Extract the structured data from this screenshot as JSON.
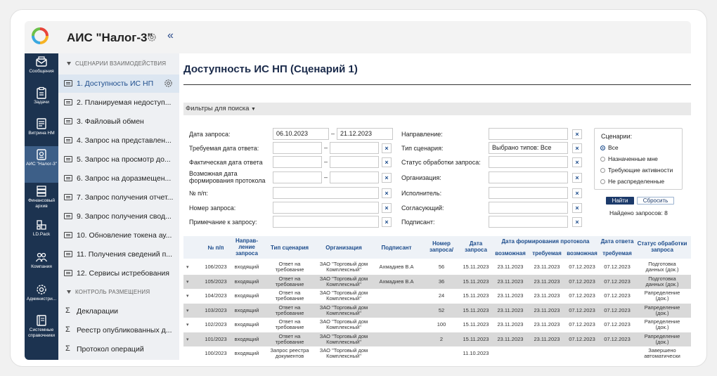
{
  "header": {
    "app_title": "АИС \"Налог-3\"",
    "collapse_glyph": "«"
  },
  "rail": [
    {
      "label": "Сообщения",
      "icon": "message-icon"
    },
    {
      "label": "Задачи",
      "icon": "clipboard-icon"
    },
    {
      "label": "Витрина НМ",
      "icon": "storefront-icon"
    },
    {
      "label": "АИС \"Налог-3\"",
      "icon": "database-icon",
      "active": true
    },
    {
      "label": "Финансовый архив",
      "icon": "archive-icon"
    },
    {
      "label": "LD.Pack",
      "icon": "package-icon"
    },
    {
      "label": "Компания",
      "icon": "people-icon"
    },
    {
      "label": "Администри...",
      "icon": "settings-icon"
    },
    {
      "label": "Системные справочники",
      "icon": "book-icon"
    }
  ],
  "nav": {
    "section1": "СЦЕНАРИИ ВЗАИМОДЕЙСТВИЯ",
    "items": [
      "1. Доступность ИС НП",
      "2. Планируемая недоступ...",
      "3. Файловый обмен",
      "4. Запрос на представлен...",
      "5. Запрос на просмотр до...",
      "6. Запрос на доразмещен...",
      "7. Запрос получения отчет...",
      "9. Запрос получения свод...",
      "10. Обновление токена ау...",
      "11. Получения сведений п...",
      "12. Сервисы истребования"
    ],
    "section2": "КОНТРОЛЬ РАЗМЕЩЕНИЯ",
    "items2": [
      "Декларации",
      "Реестр опубликованных д...",
      "Протокол операций"
    ],
    "sigma": "Σ"
  },
  "main": {
    "title": "Доступность ИС НП (Сценарий 1)",
    "filters_label": "Фильтры для поиска",
    "filter_icon": "▼"
  },
  "filters": {
    "date_request": "Дата запроса:",
    "date_from": "06.10.2023",
    "date_to": "21.12.2023",
    "required_answer": "Требуемая дата ответа:",
    "actual_date": "Фактическая дата ответа",
    "possible_date": "Возможная дата формирования протокола",
    "number": "№ п/п:",
    "request_number": "Номер запроса:",
    "note": "Примечание к запросу:",
    "direction": "Направление:",
    "scenario_type": "Тип сценария:",
    "scenario_type_value": "Выбрано типов: Все",
    "status": "Статус обработки запроса:",
    "organization": "Организация:",
    "executor": "Исполнитель:",
    "approver": "Согласующий:",
    "signer": "Подписант:",
    "dash": "–",
    "clear": "×"
  },
  "scenarios": {
    "title": "Сценарии:",
    "options": [
      "Все",
      "Назначенные мне",
      "Требующие активности",
      "Не распределенные"
    ],
    "selected": 0
  },
  "actions": {
    "find": "Найти",
    "reset": "Сбросить",
    "found": "Найдено запросов: 8"
  },
  "table": {
    "headers": {
      "num": "№ п/п",
      "direction": "Направ-\nление\nзапроса",
      "type": "Тип сценария",
      "org": "Организация",
      "signer": "Подписант",
      "reqnum": "Номер\nзапроса/",
      "reqdate": "Дата\nзапроса",
      "protocol": "Дата формирования протокола",
      "possible": "возможная",
      "required": "требуемая",
      "possible2": "возможная",
      "answer": "Дата ответа",
      "required2": "требуемая",
      "status": "Статус обработки\nзапроса"
    },
    "rows": [
      {
        "num": "106/2023",
        "dir": "входящий",
        "type": "Ответ на\nтребование",
        "org": "ЗАО \"Торговый дом\nКомплексный\"",
        "signer": "Ахмадиев В.А",
        "reqnum": "56",
        "reqdate": "15.11.2023",
        "p1": "23.11.2023",
        "p2": "23.11.2023",
        "p3": "07.12.2023",
        "a": "07.12.2023",
        "status": "Подготовка\nданных (док.)"
      },
      {
        "num": "105/2023",
        "dir": "входящий",
        "type": "Ответ на\nтребование",
        "org": "ЗАО \"Торговый дом\nКомплексный\"",
        "signer": "Ахмадиев В.А",
        "reqnum": "36",
        "reqdate": "15.11.2023",
        "p1": "23.11.2023",
        "p2": "23.11.2023",
        "p3": "07.12.2023",
        "a": "07.12.2023",
        "status": "Подготовка\nданных (док.)"
      },
      {
        "num": "104/2023",
        "dir": "входящий",
        "type": "Ответ на\nтребование",
        "org": "ЗАО \"Торговый дом\nКомплексный\"",
        "signer": "",
        "reqnum": "24",
        "reqdate": "15.11.2023",
        "p1": "23.11.2023",
        "p2": "23.11.2023",
        "p3": "07.12.2023",
        "a": "07.12.2023",
        "status": "Рапределение\n(док.)"
      },
      {
        "num": "103/2023",
        "dir": "входящий",
        "type": "Ответ на\nтребование",
        "org": "ЗАО \"Торговый дом\nКомплексный\"",
        "signer": "",
        "reqnum": "52",
        "reqdate": "15.11.2023",
        "p1": "23.11.2023",
        "p2": "23.11.2023",
        "p3": "07.12.2023",
        "a": "07.12.2023",
        "status": "Рапределение\n(док.)"
      },
      {
        "num": "102/2023",
        "dir": "входящий",
        "type": "Ответ на\nтребование",
        "org": "ЗАО \"Торговый дом\nКомплексный\"",
        "signer": "",
        "reqnum": "100",
        "reqdate": "15.11.2023",
        "p1": "23.11.2023",
        "p2": "23.11.2023",
        "p3": "07.12.2023",
        "a": "07.12.2023",
        "status": "Рапределение\n(док.)"
      },
      {
        "num": "101/2023",
        "dir": "входящий",
        "type": "Ответ на\nтребование",
        "org": "ЗАО \"Торговый дом\nКомплексный\"",
        "signer": "",
        "reqnum": "2",
        "reqdate": "15.11.2023",
        "p1": "23.11.2023",
        "p2": "23.11.2023",
        "p3": "07.12.2023",
        "a": "07.12.2023",
        "status": "Рапределение\n(док.)"
      },
      {
        "num": "100/2023",
        "dir": "входящий",
        "type": "Запрос реестра\nдокументов",
        "org": "ЗАО \"Торговый дом\nКомплексный\"",
        "signer": "",
        "reqnum": "",
        "reqdate": "11.10.2023",
        "p1": "",
        "p2": "",
        "p3": "",
        "a": "",
        "status": "Завершено\nавтоматически"
      }
    ]
  },
  "colors": {
    "rail": "#1c3350",
    "accent": "#1c4c8c",
    "row_alt": "#d9d9d9"
  }
}
